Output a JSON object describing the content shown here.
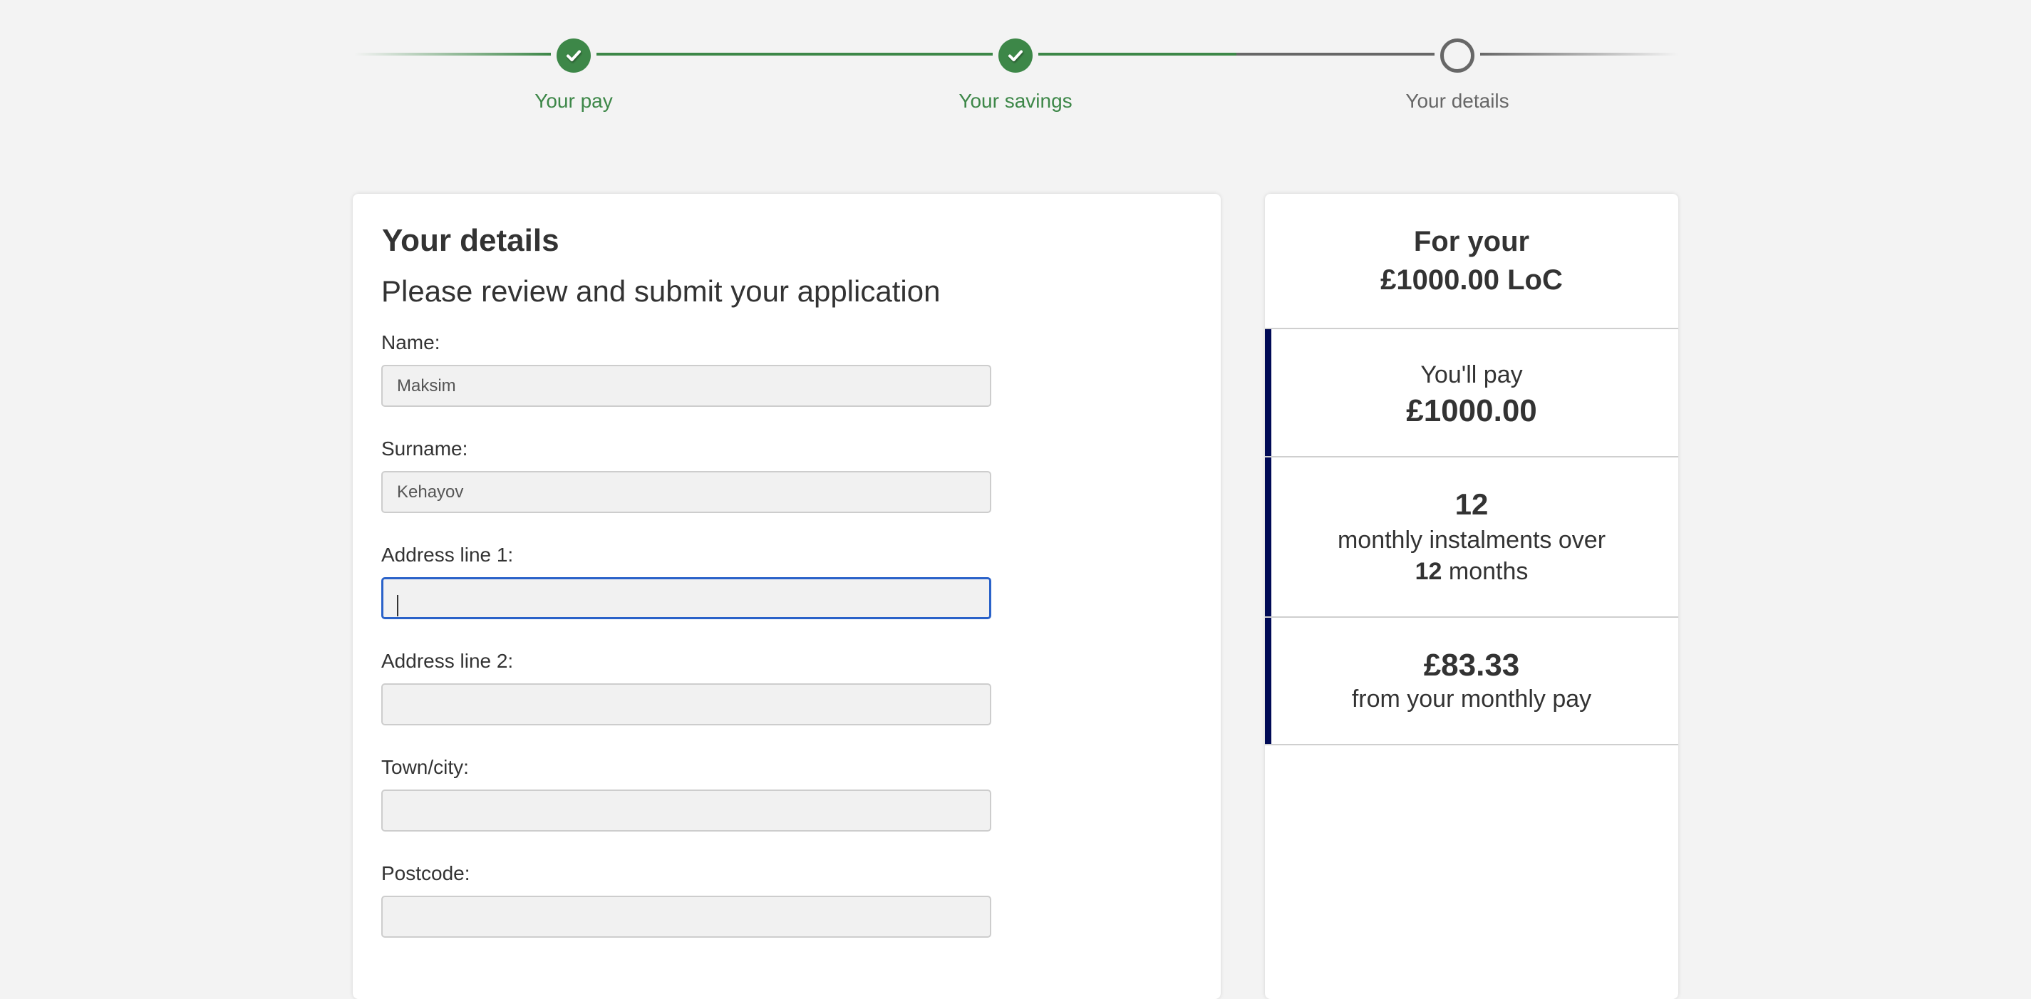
{
  "colors": {
    "complete": "#3d8748",
    "pending": "#676767",
    "accent_bar": "#000a55",
    "focus_border": "#2a62c9",
    "background": "#f3f3f3"
  },
  "stepper": {
    "steps": [
      {
        "label": "Your pay",
        "status": "complete",
        "icon": "check-icon"
      },
      {
        "label": "Your savings",
        "status": "complete",
        "icon": "check-icon"
      },
      {
        "label": "Your details",
        "status": "current",
        "icon": "empty-circle-icon"
      }
    ]
  },
  "form": {
    "title": "Your details",
    "subtitle": "Please review and submit your application",
    "fields": [
      {
        "label": "Name:",
        "value": "Maksim",
        "placeholder": "",
        "focused": false
      },
      {
        "label": "Surname:",
        "value": "Kehayov",
        "placeholder": "",
        "focused": false
      },
      {
        "label": "Address line 1:",
        "value": "",
        "placeholder": "",
        "focused": true
      },
      {
        "label": "Address line 2:",
        "value": "",
        "placeholder": "",
        "focused": false
      },
      {
        "label": "Town/city:",
        "value": "",
        "placeholder": "",
        "focused": false
      },
      {
        "label": "Postcode:",
        "value": "",
        "placeholder": "",
        "focused": false
      }
    ]
  },
  "summary": {
    "header_line1": "For your",
    "header_line2": "£1000.00 LoC",
    "pay_label": "You'll pay",
    "pay_amount": "£1000.00",
    "instalments_count": "12",
    "instalments_text": "monthly instalments over",
    "months_count": "12",
    "months_text": "months",
    "monthly_amount": "£83.33",
    "monthly_text": "from your monthly pay"
  }
}
